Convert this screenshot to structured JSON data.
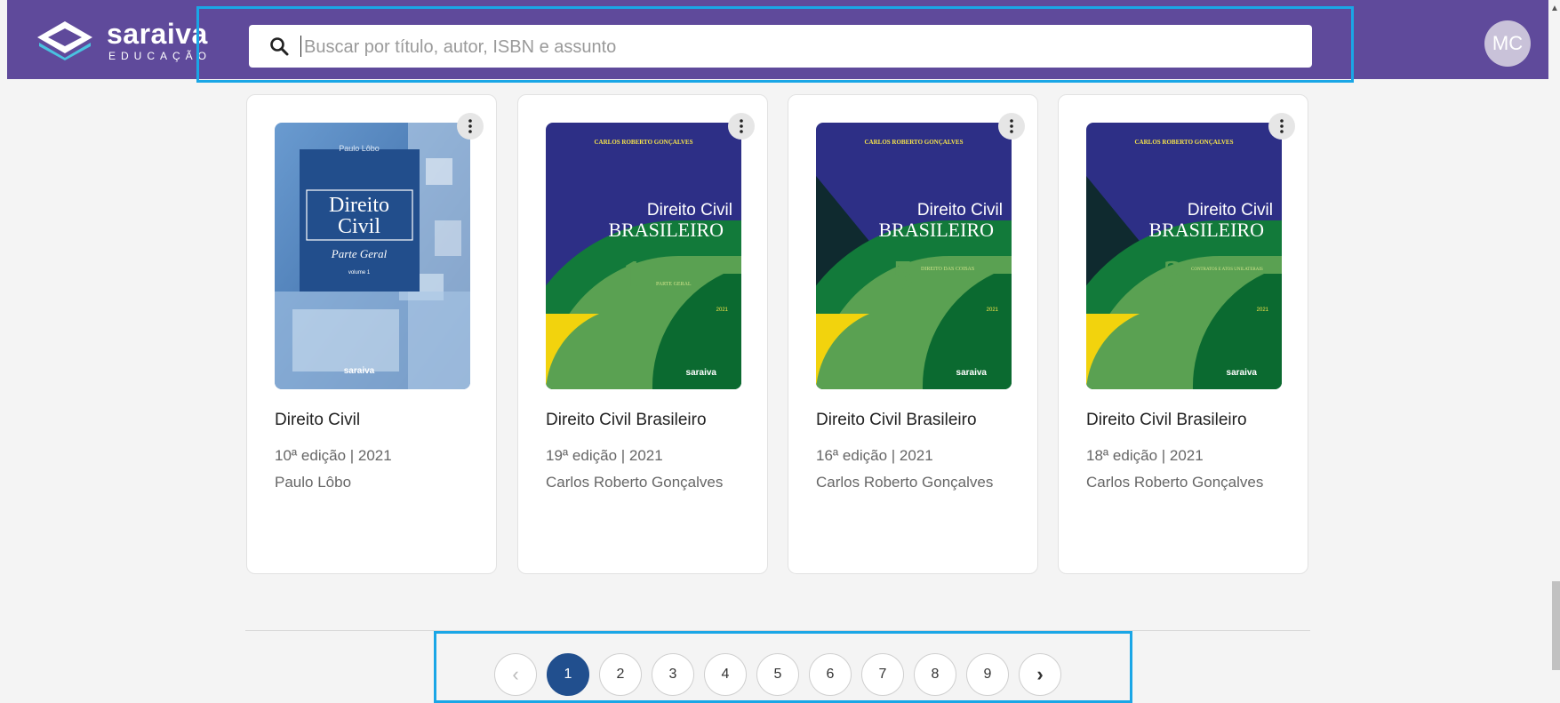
{
  "header": {
    "logo_text": "saraiva",
    "logo_sub": "EDUCAÇÃO",
    "search_placeholder": "Buscar por título, autor, ISBN e assunto",
    "avatar_initials": "MC"
  },
  "books": [
    {
      "title": "Direito Civil",
      "edition": "10ª edição | 2021",
      "author": "Paulo Lôbo",
      "cover": {
        "author": "Paulo Lôbo",
        "line1": "Direito",
        "line2": "Civil",
        "subtitle": "Parte Geral",
        "volume": "volume 1",
        "publisher": "saraiva"
      }
    },
    {
      "title": "Direito Civil Brasileiro",
      "edition": "19ª edição | 2021",
      "author": "Carlos Roberto Gonçalves",
      "cover": {
        "author": "CARLOS ROBERTO GONÇALVES",
        "line1": "Direito Civil",
        "line2": "BRASILEIRO",
        "number": "1",
        "part": "PARTE GERAL",
        "year": "2021",
        "publisher": "saraiva"
      }
    },
    {
      "title": "Direito Civil Brasileiro",
      "edition": "16ª edição | 2021",
      "author": "Carlos Roberto Gonçalves",
      "cover": {
        "author": "CARLOS ROBERTO GONÇALVES",
        "line1": "Direito Civil",
        "line2": "BRASILEIRO",
        "number": "5",
        "part": "DIREITO DAS COISAS",
        "year": "2021",
        "publisher": "saraiva"
      }
    },
    {
      "title": "Direito Civil Brasileiro",
      "edition": "18ª edição | 2021",
      "author": "Carlos Roberto Gonçalves",
      "cover": {
        "author": "CARLOS ROBERTO GONÇALVES",
        "line1": "Direito Civil",
        "line2": "BRASILEIRO",
        "number": "3",
        "part": "CONTRATOS E ATOS UNILATERAIS",
        "year": "2021",
        "publisher": "saraiva"
      }
    }
  ],
  "pagination": {
    "prev": "‹",
    "next": "›",
    "pages": [
      "1",
      "2",
      "3",
      "4",
      "5",
      "6",
      "7",
      "8",
      "9"
    ],
    "current": "1"
  },
  "colors": {
    "header": "#5f4a9b",
    "highlight": "#1aa6e6",
    "active_page": "#214f8e"
  }
}
